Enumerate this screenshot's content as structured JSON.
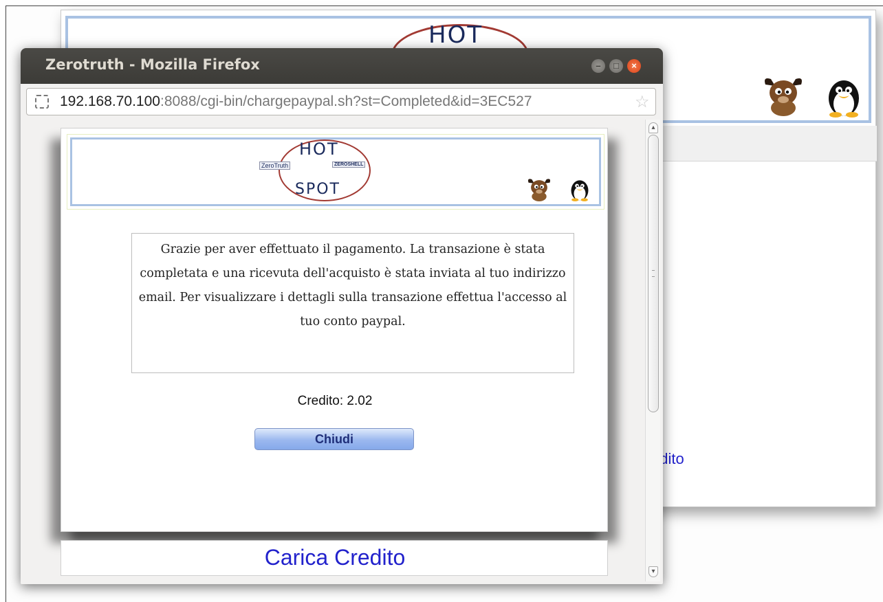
{
  "window": {
    "title": "Zerotruth - Mozilla Firefox",
    "buttons": [
      "minimize",
      "maximize",
      "close"
    ]
  },
  "urlbar": {
    "host": "192.168.70.100",
    "rest": ":8088/cgi-bin/chargepaypal.sh?st=Completed&id=3EC527"
  },
  "logo": {
    "top": "HOT",
    "bottom": "SPOT",
    "badge_left": "ZeroTruth",
    "badge_right": "ZEROSHELL"
  },
  "message": {
    "text": "Grazie per aver effettuato il pagamento. La transazione è stata completata e una ricevuta dell'acquisto è stata inviata al tuo indirizzo email. Per visualizzare i dettagli sulla transazione effettua l'accesso al tuo conto paypal."
  },
  "credit": {
    "label": "Credito: 2.02"
  },
  "close_button": {
    "label": "Chiudi"
  },
  "footer_link": {
    "label": "Carica Credito"
  },
  "background_page": {
    "link_fragment": "edito"
  },
  "icons": {
    "gnu": "gnu-mascot-icon",
    "tux": "tux-penguin-icon",
    "star": "bookmark-star-icon",
    "site": "site-identity-icon"
  },
  "colors": {
    "link": "#2222cc",
    "header_border": "#a9c2e3",
    "close_red": "#d9431a",
    "logo_red": "#a23a33"
  }
}
